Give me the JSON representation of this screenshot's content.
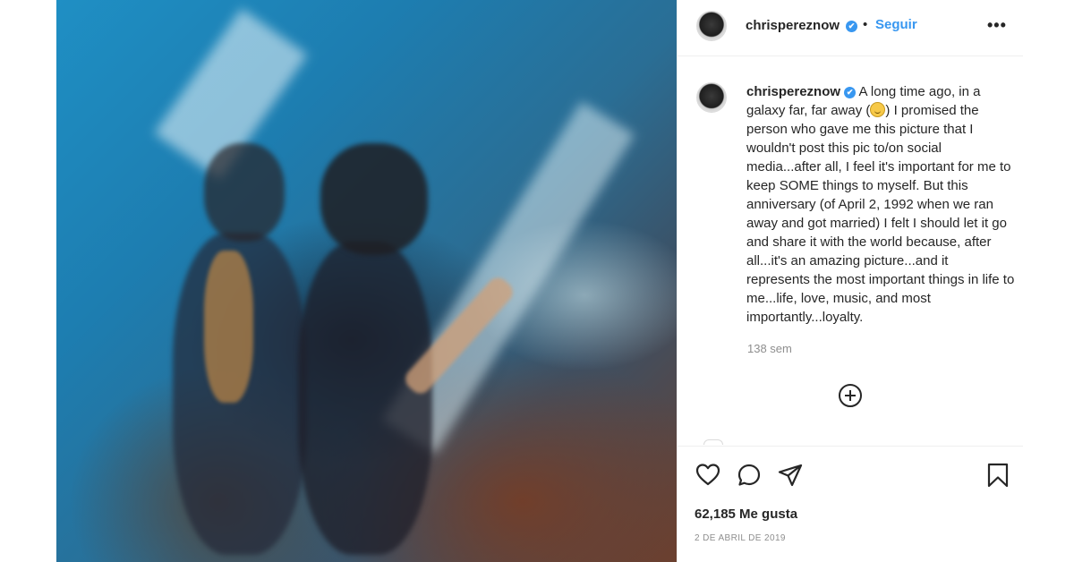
{
  "post": {
    "username": "chrispereznow",
    "separator": "•",
    "follow_label": "Seguir",
    "more_label": "•••",
    "verified_mark": "✔",
    "caption": {
      "part1": "A long time ago, in a galaxy far, far away (",
      "part2": ") I promised the person who gave me this picture that I wouldn't post this pic to/on social media...after all, I feel it's important for me to keep SOME things to myself. But this anniversary (of April 2, 1992 when we ran away and got married) I felt I should let it go and share it with the world because, after all...it's an amazing picture...and it represents the most important things in life to me...life, love, music, and most importantly...loyalty."
    },
    "time_ago": "138 sem",
    "likes": "62,185 Me gusta",
    "date": "2 DE ABRIL DE 2019"
  },
  "icons": {
    "like": "heart-icon",
    "comment": "comment-icon",
    "share": "paper-plane-icon",
    "save": "bookmark-icon",
    "add_comment": "plus-circle-icon",
    "emoji": "wink-emoji"
  },
  "colors": {
    "accent": "#3897f0",
    "text": "#262626",
    "muted": "#8e8e8e",
    "border": "#efefef"
  }
}
